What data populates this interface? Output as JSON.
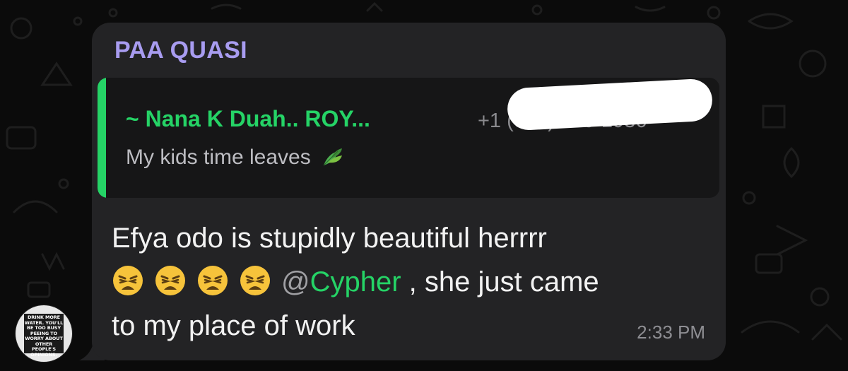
{
  "chat": {
    "sender_name": "PAA QUASI",
    "quoted_author": "~ Nana K Duah.. ROY...",
    "quoted_phone": "+1 (000) 000-1936",
    "quoted_text": "My kids time leaves",
    "message_line1": "Efya odo is stupidly beautiful herrrr",
    "mention_at": "@",
    "mention_name": "Cypher",
    "message_after_mention": " , she just came",
    "message_line3": "to my place of work",
    "timestamp": "2:33 PM",
    "avatar_text": "DRINK MORE WATER. YOU'LL BE TOO BUSY PEEING TO WORRY ABOUT OTHER PEOPLE'S OPINIONS."
  },
  "colors": {
    "sender": "#a89cf0",
    "mention": "#25d366",
    "quote_accent": "#25d366",
    "bubble": "#232325",
    "background": "#0b0b0b"
  },
  "icons": {
    "quoted_emoji": "herb-icon",
    "weary_emoji": "weary-face-icon"
  }
}
